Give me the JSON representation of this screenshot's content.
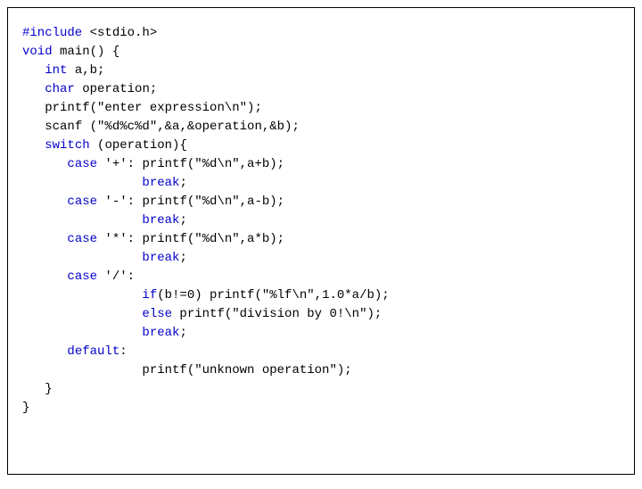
{
  "code": {
    "include_kw": "#include",
    "include_rest": " <stdio.h>",
    "void_kw": "void",
    "main_rest": " main() {",
    "indent1": "   ",
    "int_kw": "int",
    "int_rest": " a,b;",
    "char_kw": "char",
    "char_rest": " operation;",
    "printf1": "printf(\"enter expression\\n\");",
    "scanf": "scanf (\"%d%c%d\",&a,&operation,&b);",
    "switch_kw": "switch",
    "switch_rest": " (operation){",
    "indent2": "      ",
    "case_kw": "case",
    "case_plus_rest": " '+': printf(\"%d\\n\",a+b);",
    "indent3": "                ",
    "break_kw": "break",
    "semi": ";",
    "case_minus_rest": " '-': printf(\"%d\\n\",a-b);",
    "case_star_rest": " '*': printf(\"%d\\n\",a*b);",
    "case_slash_rest": " '/':",
    "ifline": "if",
    "ifline_rest": "(b!=0) printf(\"%lf\\n\",1.0*a/b);",
    "else_kw": "else",
    "else_rest": " printf(\"division by 0!\\n\");",
    "default_kw": "default",
    "default_rest": ":",
    "default_printf": "printf(\"unknown operation\");",
    "rbrace1": "   }",
    "rbrace2": "}"
  }
}
